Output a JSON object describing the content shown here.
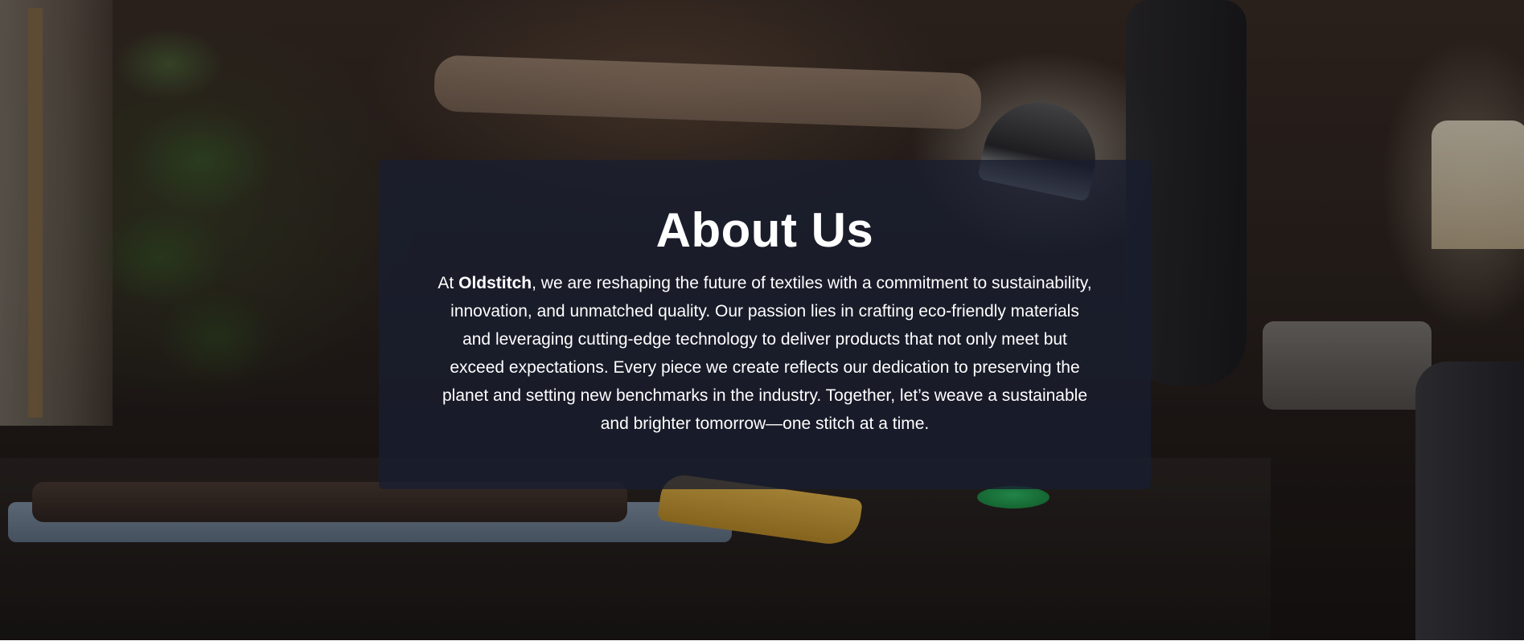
{
  "about": {
    "title": "About Us",
    "body_prefix": "At ",
    "brand": "Oldstitch",
    "body_suffix": ", we are reshaping the future of textiles with a commitment to sustainability, innovation, and unmatched quality. Our passion lies in crafting eco-friendly materials and leveraging cutting-edge technology to deliver products that not only meet but exceed expectations. Every piece we create reflects our dedication to preserving the planet and setting new benchmarks in the industry. Together, let’s weave a sustainable and brighter tomorrow—one stitch at a time."
  },
  "colors": {
    "overlay": "#181e30",
    "text": "#ffffff"
  }
}
